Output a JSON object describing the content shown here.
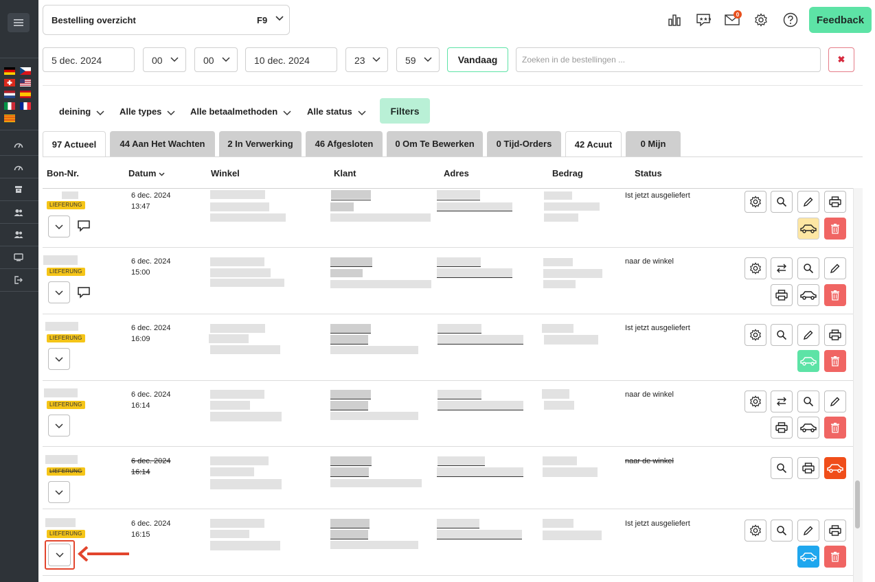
{
  "header": {
    "page_title": "Bestelling overzicht",
    "page_shortcut": "F9",
    "mail_count": "0",
    "feedback_label": "Feedback",
    "icons": [
      "chart-bar-icon",
      "reviews-icon",
      "mail-icon",
      "gear-icon",
      "help-icon"
    ]
  },
  "sidebar": {
    "flags": [
      "de",
      "cz",
      "ch",
      "us",
      "nl",
      "es",
      "it",
      "fr",
      "catalonia"
    ],
    "icons": [
      "dashboard-icon",
      "dashboard-icon",
      "archive-icon",
      "users-icon",
      "users-icon",
      "monitor-icon",
      "logout-icon"
    ]
  },
  "dates": {
    "from_date": "5 dec. 2024",
    "from_hour": "00",
    "from_minute": "00",
    "to_date": "10 dec. 2024",
    "to_hour": "23",
    "to_minute": "59",
    "today_label": "Vandaag",
    "search_placeholder": "Zoeken in de bestellingen ...",
    "clear_icon": "✖"
  },
  "filters": {
    "branch": "deining",
    "types": "Alle types",
    "payment": "Alle betaalmethoden",
    "status": "Alle status",
    "filters_label": "Filters"
  },
  "tabs": [
    {
      "label": "97 Actueel",
      "active": true
    },
    {
      "label": "44 Aan Het Wachten",
      "active": false
    },
    {
      "label": "2 In Verwerking",
      "active": false
    },
    {
      "label": "46 Afgesloten",
      "active": false
    },
    {
      "label": "0 Om Te Bewerken",
      "active": false
    },
    {
      "label": "0 Tijd-Orders",
      "active": false
    },
    {
      "label": "42 Acuut",
      "active": true
    },
    {
      "label": "0 Mijn",
      "active": false
    }
  ],
  "columns": {
    "bon": "Bon-Nr.",
    "datum": "Datum",
    "winkel": "Winkel",
    "klant": "Klant",
    "adres": "Adres",
    "bedrag": "Bedrag",
    "status": "Status"
  },
  "rows": [
    {
      "badge": "LIEFERUNG",
      "date": "6 dec. 2024",
      "time": "13:47",
      "status": "Ist jetzt ausgeliefert"
    },
    {
      "badge": "LIEFERUNG",
      "date": "6 dec. 2024",
      "time": "15:00",
      "status": "naar de winkel"
    },
    {
      "badge": "LIEFERUNG",
      "date": "6 dec. 2024",
      "time": "16:09",
      "status": "Ist jetzt ausgeliefert"
    },
    {
      "badge": "LIEFERUNG",
      "date": "6 dec. 2024",
      "time": "16:14",
      "status": "naar de winkel"
    },
    {
      "badge": "LIEFERUNG",
      "date": "6 dec. 2024",
      "time": "16:14",
      "status": "naar de winkel"
    },
    {
      "badge": "LIEFERUNG",
      "date": "6 dec. 2024",
      "time": "16:15",
      "status": "Ist jetzt ausgeliefert"
    }
  ],
  "colors": {
    "accent_green": "#5de3a6",
    "delete_red": "#f06563",
    "badge_yellow": "#f5c518",
    "car_orange": "#f04e1a",
    "car_blue": "#1fa7ee",
    "car_yellow": "#fde6a3"
  }
}
